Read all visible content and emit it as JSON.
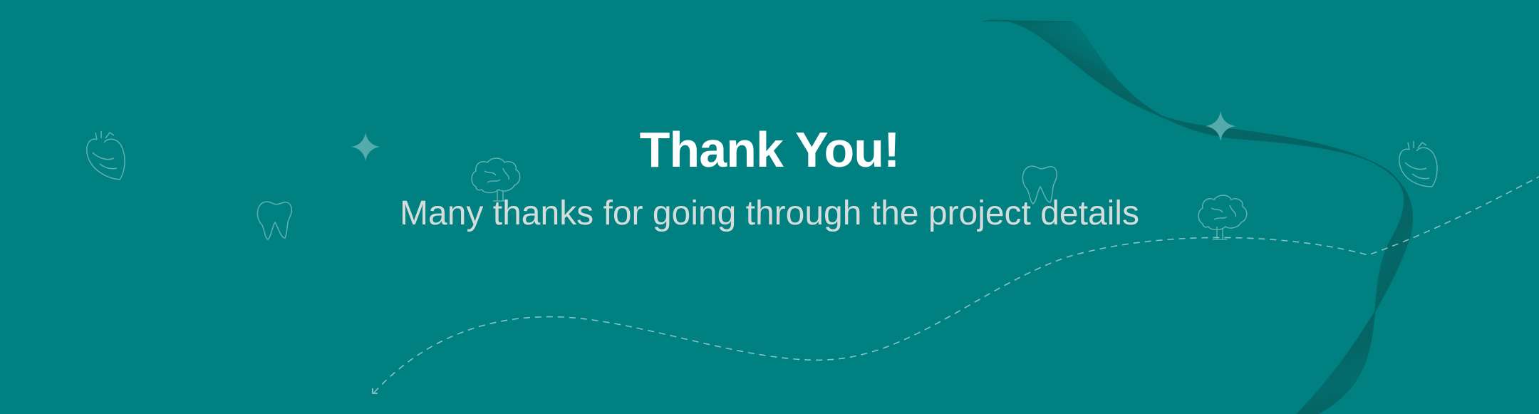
{
  "slide": {
    "title": "Thank You!",
    "subtitle": "Many thanks for going through the project details"
  },
  "colors": {
    "background": "#008080",
    "title": "#ffffff",
    "subtitle": "#d4dcdc",
    "line_art": "#7fc2c2",
    "sparkle": "#55abab",
    "wave_lines": "#0b4f4f"
  },
  "decorations": {
    "icons": [
      "heart-icon",
      "tooth-icon",
      "brain-icon",
      "sparkle-icon"
    ]
  }
}
